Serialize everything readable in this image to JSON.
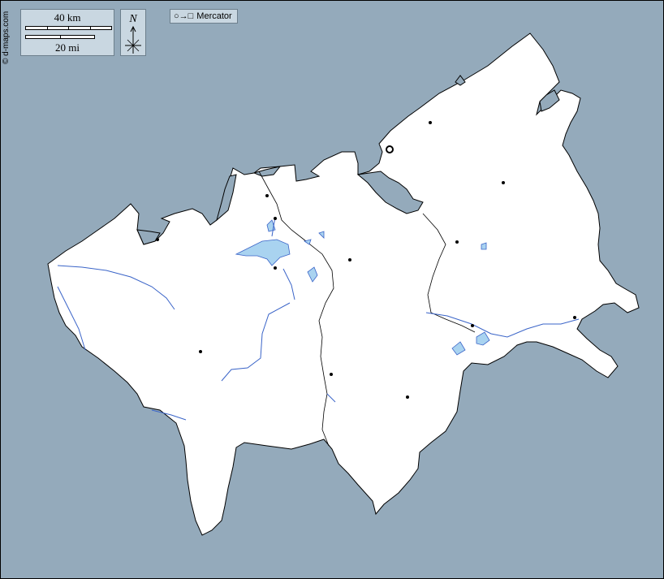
{
  "map": {
    "credit": "© d-maps.com",
    "projection_label": "Mercator",
    "projection_symbol": "○→□",
    "scale_km_label": "40 km",
    "scale_mi_label": "20 mi",
    "north_label": "N",
    "colors": {
      "sea": "#94aabb",
      "land": "#ffffff",
      "water": "#a9d3f0",
      "river": "#3a64c8",
      "border": "#000000"
    },
    "city_count": 13,
    "capital_symbol": "ring"
  }
}
